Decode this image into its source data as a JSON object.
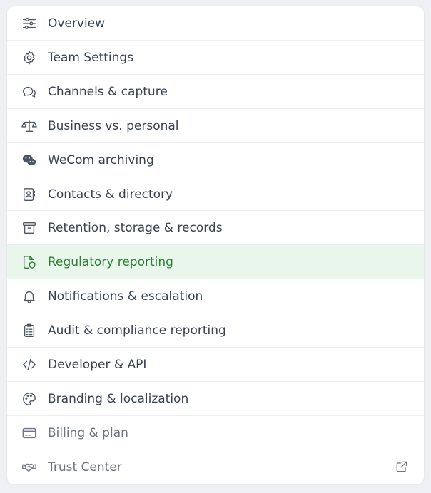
{
  "menu": {
    "items": [
      {
        "label": "Overview",
        "icon": "sliders-icon"
      },
      {
        "label": "Team Settings",
        "icon": "gear-icon"
      },
      {
        "label": "Channels & capture",
        "icon": "chat-bubbles-icon"
      },
      {
        "label": "Business vs. personal",
        "icon": "scale-icon"
      },
      {
        "label": "WeCom archiving",
        "icon": "wechat-icon"
      },
      {
        "label": "Contacts & directory",
        "icon": "contact-book-icon"
      },
      {
        "label": "Retention, storage & records",
        "icon": "archive-box-icon"
      },
      {
        "label": "Regulatory reporting",
        "icon": "document-shield-icon",
        "active": true
      },
      {
        "label": "Notifications & escalation",
        "icon": "bell-icon"
      },
      {
        "label": "Audit & compliance reporting",
        "icon": "clipboard-list-icon"
      },
      {
        "label": "Developer & API",
        "icon": "code-icon"
      },
      {
        "label": "Branding & localization",
        "icon": "palette-icon"
      },
      {
        "label": "Billing & plan",
        "icon": "credit-card-icon"
      },
      {
        "label": "Trust Center",
        "icon": "handshake-icon",
        "external_icon": "external-link-icon"
      }
    ]
  },
  "colors": {
    "active_bg": "#e9f6ec",
    "active_text": "#2e7d32",
    "text": "#374151",
    "muted_text": "#6b7280"
  }
}
